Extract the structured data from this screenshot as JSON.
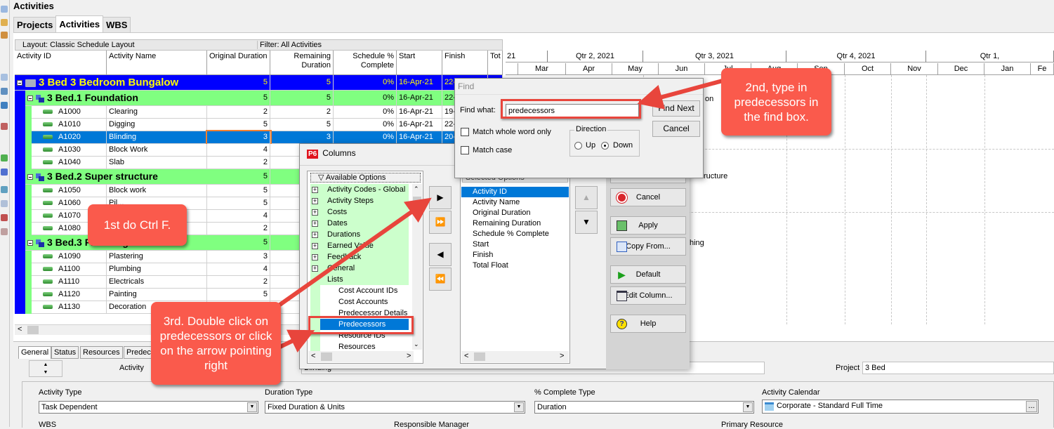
{
  "window": {
    "title": "Activities"
  },
  "tabs": [
    {
      "label": "Projects",
      "active": false
    },
    {
      "label": "Activities",
      "active": true
    },
    {
      "label": "WBS",
      "active": false
    }
  ],
  "layout_bar": {
    "layout": "Layout: Classic Schedule Layout",
    "filter": "Filter: All Activities"
  },
  "columns": [
    "Activity ID",
    "Activity Name",
    "Original Duration",
    "Remaining Duration",
    "Schedule % Complete",
    "Start",
    "Finish",
    "Tot"
  ],
  "rows": [
    {
      "type": "project",
      "id": "3  Bed  3 Bedroom Bungalow",
      "orig": "5",
      "rem": "5",
      "pct": "0%",
      "start": "16-Apr-21",
      "finish": "22-"
    },
    {
      "type": "wbs",
      "id": "3  Bed.1  Foundation",
      "orig": "5",
      "rem": "5",
      "pct": "0%",
      "start": "16-Apr-21",
      "finish": "22-"
    },
    {
      "type": "task",
      "id": "A1000",
      "name": "Clearing",
      "orig": "2",
      "rem": "2",
      "pct": "0%",
      "start": "16-Apr-21",
      "finish": "19-"
    },
    {
      "type": "task",
      "id": "A1010",
      "name": "Digging",
      "orig": "5",
      "rem": "5",
      "pct": "0%",
      "start": "16-Apr-21",
      "finish": "22-"
    },
    {
      "type": "task",
      "id": "A1020",
      "name": "Blinding",
      "orig": "3",
      "rem": "3",
      "pct": "0%",
      "start": "16-Apr-21",
      "finish": "20-",
      "selected": true
    },
    {
      "type": "task",
      "id": "A1030",
      "name": "Block Work",
      "orig": "4",
      "rem": "",
      "pct": "",
      "start": "",
      "finish": ""
    },
    {
      "type": "task",
      "id": "A1040",
      "name": "Slab",
      "orig": "2",
      "rem": "",
      "pct": "",
      "start": "",
      "finish": ""
    },
    {
      "type": "wbs",
      "id": "3  Bed.2  Super structure",
      "orig": "5",
      "rem": "",
      "pct": "",
      "start": "",
      "finish": ""
    },
    {
      "type": "task",
      "id": "A1050",
      "name": "Block work",
      "orig": "5",
      "rem": "",
      "pct": "",
      "start": "",
      "finish": ""
    },
    {
      "type": "task",
      "id": "A1060",
      "name": "Pil...",
      "orig": "5",
      "rem": "",
      "pct": "",
      "start": "",
      "finish": ""
    },
    {
      "type": "task",
      "id": "A1070",
      "name": "",
      "orig": "4",
      "rem": "",
      "pct": "",
      "start": "",
      "finish": ""
    },
    {
      "type": "task",
      "id": "A1080",
      "name": "",
      "orig": "2",
      "rem": "",
      "pct": "",
      "start": "",
      "finish": ""
    },
    {
      "type": "wbs",
      "id": "3  Bed.3  Finishing",
      "orig": "5",
      "rem": "",
      "pct": "",
      "start": "",
      "finish": ""
    },
    {
      "type": "task",
      "id": "A1090",
      "name": "Plastering",
      "orig": "3",
      "rem": "",
      "pct": "",
      "start": "",
      "finish": ""
    },
    {
      "type": "task",
      "id": "A1100",
      "name": "Plumbing",
      "orig": "4",
      "rem": "",
      "pct": "",
      "start": "",
      "finish": ""
    },
    {
      "type": "task",
      "id": "A1110",
      "name": "Electricals",
      "orig": "2",
      "rem": "",
      "pct": "",
      "start": "",
      "finish": ""
    },
    {
      "type": "task",
      "id": "A1120",
      "name": "Painting",
      "orig": "5",
      "rem": "",
      "pct": "",
      "start": "",
      "finish": ""
    },
    {
      "type": "task",
      "id": "A1130",
      "name": "Decoration",
      "orig": "",
      "rem": "",
      "pct": "",
      "start": "",
      "finish": ""
    }
  ],
  "gantt": {
    "quarters": [
      "21",
      "Qtr 2, 2021",
      "Qtr 3, 2021",
      "Qtr 4, 2021",
      "Qtr 1,"
    ],
    "months": [
      "",
      "Mar",
      "Apr",
      "May",
      "Jun",
      "Jul",
      "Aug",
      "Sep",
      "Oct",
      "Nov",
      "Dec",
      "Jan",
      "Fe"
    ],
    "bar_labels": [
      "on",
      "ructure",
      "hing"
    ]
  },
  "details": {
    "tabs": [
      "General",
      "Status",
      "Resources",
      "Predec"
    ],
    "activity_label": "Activity",
    "activity_name": "Blinding",
    "project_label": "Project",
    "project_value": "3  Bed",
    "activity_type_label": "Activity Type",
    "activity_type": "Task Dependent",
    "duration_type_label": "Duration Type",
    "duration_type": "Fixed Duration & Units",
    "pct_type_label": "% Complete Type",
    "pct_type": "Duration",
    "calendar_label": "Activity Calendar",
    "calendar": "Corporate - Standard Full Time",
    "calendar_btn": "...",
    "wbs_label": "WBS",
    "manager_label": "Responsible Manager",
    "resource_label": "Primary Resource"
  },
  "columns_dialog": {
    "logo": "P6",
    "title": "Columns",
    "available_header": "Available Options",
    "available": [
      {
        "label": "Activity Codes - Global",
        "group": true
      },
      {
        "label": "Activity Steps",
        "group": true
      },
      {
        "label": "Costs",
        "group": true
      },
      {
        "label": "Dates",
        "group": true
      },
      {
        "label": "Durations",
        "group": true
      },
      {
        "label": "Earned Value",
        "group": true
      },
      {
        "label": "Feedback",
        "group": true
      },
      {
        "label": "General",
        "group": true
      },
      {
        "label": "Lists",
        "group": true,
        "expanded": true
      },
      {
        "label": "Cost Account IDs",
        "group": false
      },
      {
        "label": "Cost Accounts",
        "group": false
      },
      {
        "label": "Predecessor Details",
        "group": false
      },
      {
        "label": "Predecessors",
        "group": false,
        "selected": true
      },
      {
        "label": "Resource IDs",
        "group": false
      },
      {
        "label": "Resources",
        "group": false
      }
    ],
    "selected_header": "Selected Options",
    "selected": [
      "Activity ID",
      "Activity Name",
      "Original Duration",
      "Remaining Duration",
      "Schedule % Complete",
      "Start",
      "Finish",
      "Total Float"
    ],
    "move_buttons": {
      "add": "▶",
      "add_all": "⏩",
      "remove": "◀",
      "remove_all": "⏪",
      "up": "▲",
      "down": "▼"
    },
    "buttons": [
      "Cancel",
      "Apply",
      "Copy From...",
      "Default",
      "Edit Column...",
      "Help"
    ]
  },
  "find_dialog": {
    "title": "Find",
    "find_what_label": "Find what:",
    "find_what_value": "predecessors",
    "find_next": "Find Next",
    "cancel": "Cancel",
    "match_whole_word": "Match whole word only",
    "match_case": "Match case",
    "direction_label": "Direction",
    "up": "Up",
    "down": "Down",
    "direction": "Down"
  },
  "callouts": {
    "first": "1st do Ctrl F.",
    "second": "2nd, type in predecessors in the find box.",
    "third": "3rd. Double click on predecessors or click on the arrow pointing right"
  },
  "colors": {
    "project_row": "#0000ff",
    "wbs_row": "#80ff80",
    "selection": "#0078d7",
    "callout": "#fa5a4c"
  }
}
